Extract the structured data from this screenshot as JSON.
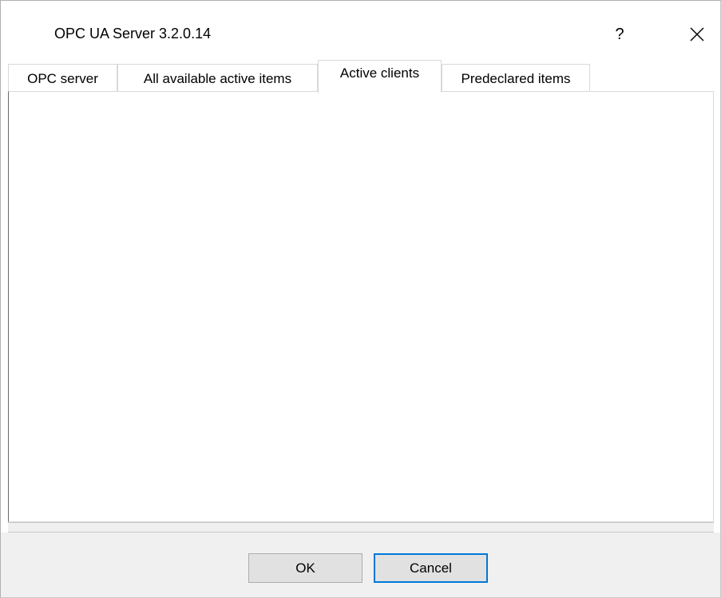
{
  "window": {
    "title": "OPC UA Server 3.2.0.14",
    "help_label": "?",
    "close_icon": "close-icon"
  },
  "tabs": [
    {
      "label": "OPC server",
      "active": false
    },
    {
      "label": "All available active items",
      "active": false
    },
    {
      "label": "Active clients",
      "active": true
    },
    {
      "label": "Predeclared items",
      "active": false
    }
  ],
  "buttons": {
    "ok_label": "OK",
    "cancel_label": "Cancel"
  },
  "colors": {
    "accent": "#0078d7",
    "footer_bg": "#f0f0f0",
    "button_bg": "#e1e1e1"
  }
}
